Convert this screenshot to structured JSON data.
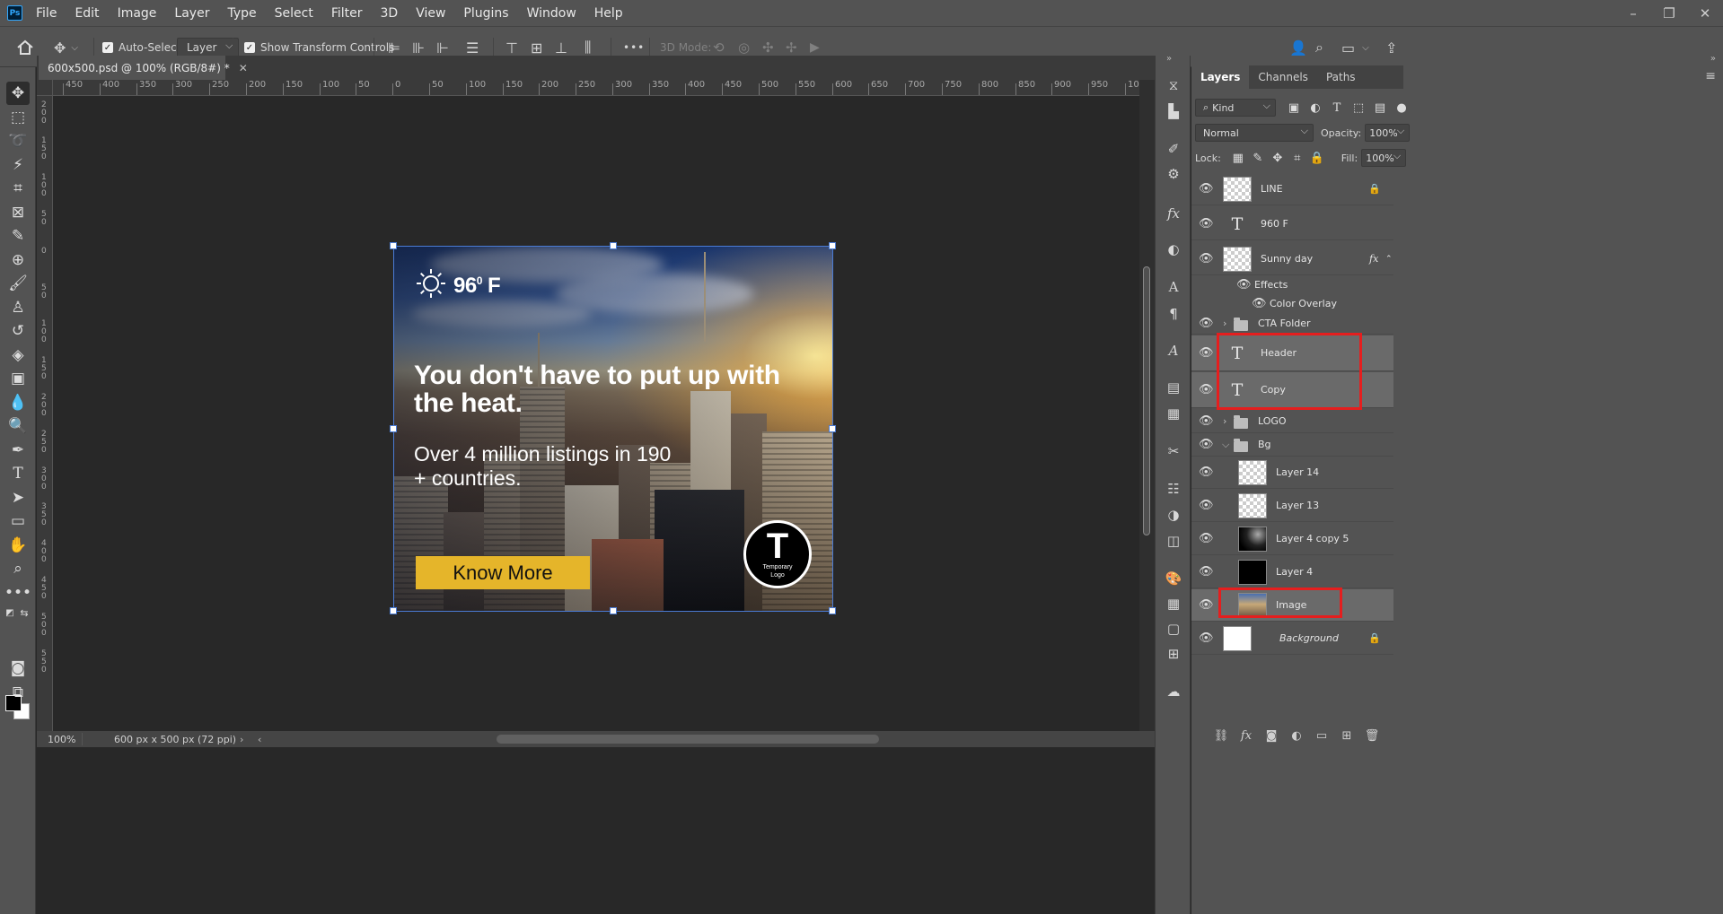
{
  "app": {
    "logo": "Ps",
    "window_buttons": [
      "–",
      "❐",
      "✕"
    ]
  },
  "menu": [
    "File",
    "Edit",
    "Image",
    "Layer",
    "Type",
    "Select",
    "Filter",
    "3D",
    "View",
    "Plugins",
    "Window",
    "Help"
  ],
  "options": {
    "auto_select_label": "Auto-Select:",
    "auto_select_target": "Layer",
    "show_transform_label": "Show Transform Controls",
    "more": "•••",
    "mode_3d_label": "3D Mode:"
  },
  "document": {
    "tab_title": "600x500.psd @ 100% (RGB/8#) *",
    "zoom": "100%",
    "doc_info": "600 px x 500 px (72 ppi)"
  },
  "rulers": {
    "horizontal": [
      "450",
      "400",
      "350",
      "300",
      "250",
      "200",
      "150",
      "100",
      "50",
      "0",
      "50",
      "100",
      "150",
      "200",
      "250",
      "300",
      "350",
      "400",
      "450",
      "500",
      "550",
      "600",
      "650",
      "700",
      "750",
      "800",
      "850",
      "900",
      "950",
      "100"
    ],
    "vertical": [
      "2 0 0",
      "1 5 0",
      "1 0 0",
      "5 0",
      "0",
      "5 0",
      "1 0 0",
      "1 5 0",
      "2 0 0",
      "2 5 0",
      "3 0 0",
      "3 5 0",
      "4 0 0",
      "4 5 0",
      "5 0 0",
      "5 5 0"
    ]
  },
  "artwork": {
    "temperature": "96",
    "temperature_unit_sup": "0",
    "temperature_unit": " F",
    "header": "You don't have to put up with the heat.",
    "copy": "Over 4 million listings in 190 + countries.",
    "cta": "Know More",
    "logo_letter": "T",
    "logo_text": "Temporary Logo"
  },
  "layers_panel": {
    "tabs": [
      "Layers",
      "Channels",
      "Paths"
    ],
    "filter_kind": "Kind",
    "blend_mode": "Normal",
    "opacity_label": "Opacity:",
    "opacity_value": "100%",
    "lock_label": "Lock:",
    "fill_label": "Fill:",
    "fill_value": "100%",
    "layers": [
      {
        "name": "LINE",
        "kind": "checker",
        "locked": true
      },
      {
        "name": "960 F",
        "kind": "text"
      },
      {
        "name": "Sunny day",
        "kind": "checker-smart",
        "fx": "fx"
      },
      {
        "name": "Effects",
        "kind": "effects"
      },
      {
        "name": "Color Overlay",
        "kind": "effect"
      },
      {
        "name": "CTA Folder",
        "kind": "folder"
      },
      {
        "name": "Header",
        "kind": "text",
        "selected": true
      },
      {
        "name": "Copy",
        "kind": "text",
        "selected": true
      },
      {
        "name": "LOGO",
        "kind": "folder"
      },
      {
        "name": "Bg",
        "kind": "folder-open"
      },
      {
        "name": "Layer 14",
        "kind": "checker"
      },
      {
        "name": "Layer 13",
        "kind": "checker"
      },
      {
        "name": "Layer 4 copy 5",
        "kind": "grad"
      },
      {
        "name": "Layer 4",
        "kind": "black"
      },
      {
        "name": "Image",
        "kind": "city",
        "selected": true
      },
      {
        "name": "Background",
        "kind": "white",
        "locked": true
      }
    ]
  },
  "colors": {
    "accent_selection": "#4a7bd4",
    "highlight_box": "#e51e1e",
    "cta_yellow": "#e5b52a"
  }
}
